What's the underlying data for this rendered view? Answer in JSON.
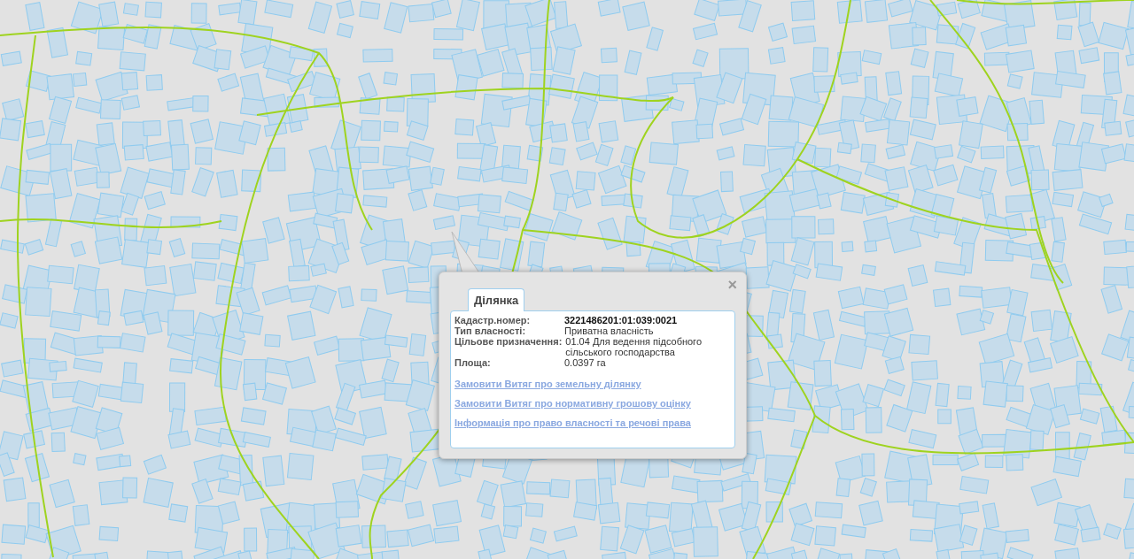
{
  "popup": {
    "tabs": [
      {
        "label": "Ділянка",
        "selected": true
      }
    ],
    "fields": [
      {
        "label": "Кадастр.номер:",
        "value": "3221486201:01:039:0021",
        "kind": "bold"
      },
      {
        "label": "Тип власності:",
        "value": "Приватна власність",
        "kind": "plain"
      },
      {
        "label": "Цільове призначення:",
        "value": "01.04 Для ведення підсобного сільського господарства",
        "kind": "plain"
      },
      {
        "label": "Площа:",
        "value": "0.0397 га",
        "kind": "plain"
      }
    ],
    "links": [
      "Замовити Витяг про земельну ділянку",
      "Замовити Витяг про нормативну грошову оцінку",
      "Інформація про право власності та речові права"
    ],
    "close": "×"
  }
}
